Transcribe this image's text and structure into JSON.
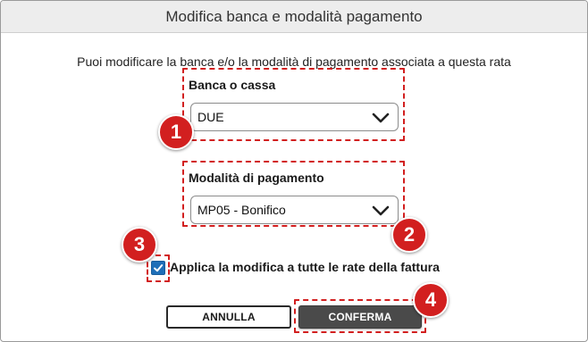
{
  "dialog": {
    "title": "Modifica banca e modalità pagamento",
    "intro": "Puoi modificare la banca e/o la modalità di pagamento associata a questa rata"
  },
  "bank": {
    "label": "Banca o cassa",
    "selected": "DUE",
    "icon": "chevron-down-icon"
  },
  "payment": {
    "label": "Modalità di pagamento",
    "selected": "MP05 - Bonifico",
    "icon": "chevron-down-icon"
  },
  "apply_all": {
    "label": "Applica la modifica a tutte le rate della fattura",
    "checked": true
  },
  "buttons": {
    "cancel": "ANNULLA",
    "confirm": "CONFERMA"
  },
  "callouts": [
    "1",
    "2",
    "3",
    "4"
  ],
  "colors": {
    "callout": "#d21f1f",
    "checkbox": "#1f6fb8",
    "primary_button": "#4a4a4a",
    "header_bg": "#ededed"
  }
}
